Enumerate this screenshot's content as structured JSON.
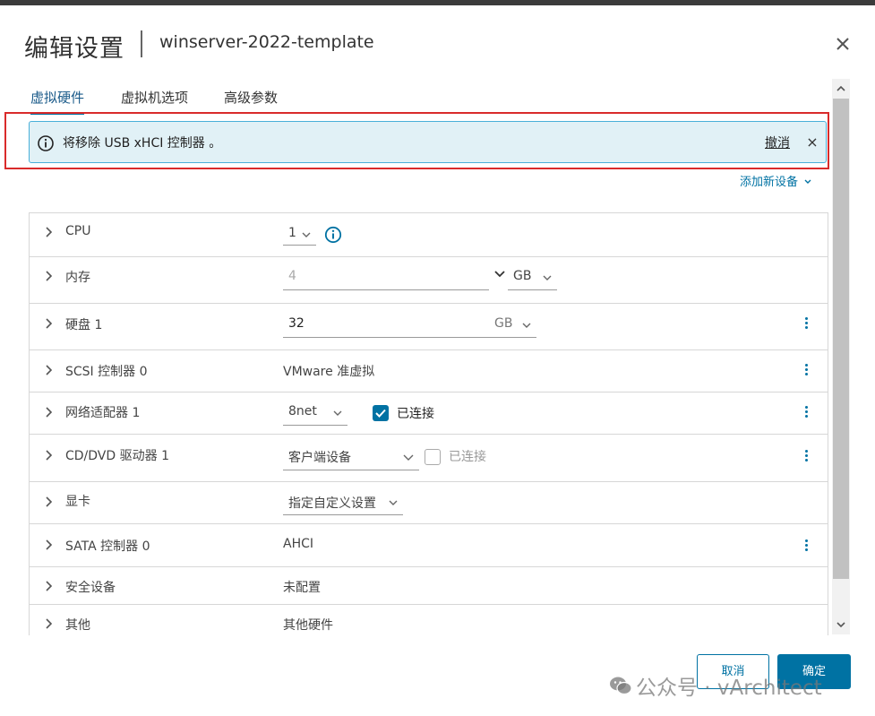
{
  "dialog": {
    "title": "编辑设置",
    "subtitle": "winserver-2022-template",
    "close_icon": "close-icon"
  },
  "tabs": [
    {
      "label": "虚拟硬件",
      "active": true
    },
    {
      "label": "虚拟机选项",
      "active": false
    },
    {
      "label": "高级参数",
      "active": false
    }
  ],
  "alert": {
    "text": "将移除 USB xHCI 控制器 。",
    "undo_label": "撤消",
    "close_glyph": "×",
    "icon": "info-icon"
  },
  "add_device_label": "添加新设备",
  "hardware": {
    "cpu": {
      "label": "CPU",
      "value": "1"
    },
    "memory": {
      "label": "内存",
      "value": "4",
      "unit": "GB"
    },
    "disk": {
      "label": "硬盘 1",
      "value": "32",
      "unit": "GB"
    },
    "scsi": {
      "label": "SCSI 控制器 0",
      "value": "VMware 准虚拟"
    },
    "network": {
      "label": "网络适配器 1",
      "value": "8net",
      "connected_label": "已连接",
      "connected": true
    },
    "cddvd": {
      "label": "CD/DVD 驱动器 1",
      "value": "客户端设备",
      "connected_label": "已连接",
      "connected": false
    },
    "video": {
      "label": "显卡",
      "value": "指定自定义设置"
    },
    "sata": {
      "label": "SATA 控制器 0",
      "value": "AHCI"
    },
    "security": {
      "label": "安全设备",
      "value": "未配置"
    },
    "other": {
      "label": "其他",
      "value": "其他硬件"
    }
  },
  "footer": {
    "cancel_label": "取消",
    "ok_label": "确定"
  },
  "watermark": "公众号 · vArchitect",
  "colors": {
    "accent": "#0072a3",
    "alert_bg": "#e1f1f6",
    "alert_border": "#49afd9",
    "highlight": "#d92b2b"
  }
}
